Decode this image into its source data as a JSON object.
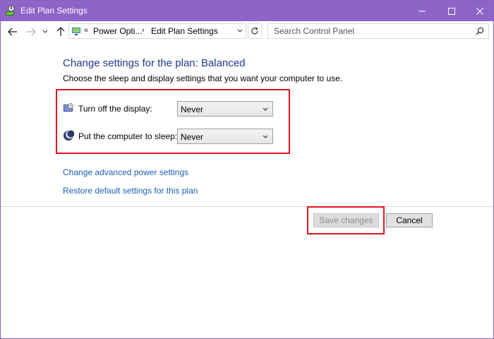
{
  "window": {
    "title": "Edit Plan Settings",
    "accent_color": "#8d64c8"
  },
  "nav": {
    "crumb_sep": "«",
    "crumb_1": "Power Opti...",
    "crumb_arrow": "›",
    "crumb_2": "Edit Plan Settings",
    "search_placeholder": "Search Control Panel"
  },
  "content": {
    "heading": "Change settings for the plan: Balanced",
    "subtitle": "Choose the sleep and display settings that you want your computer to use.",
    "settings": [
      {
        "label": "Turn off the display:",
        "value": "Never",
        "icon": "display-icon"
      },
      {
        "label": "Put the computer to sleep:",
        "value": "Never",
        "icon": "moon-icon"
      }
    ],
    "links": {
      "advanced": "Change advanced power settings",
      "restore": "Restore default settings for this plan"
    }
  },
  "buttons": {
    "save": "Save changes",
    "cancel": "Cancel"
  },
  "highlight_color": "#e0141e"
}
